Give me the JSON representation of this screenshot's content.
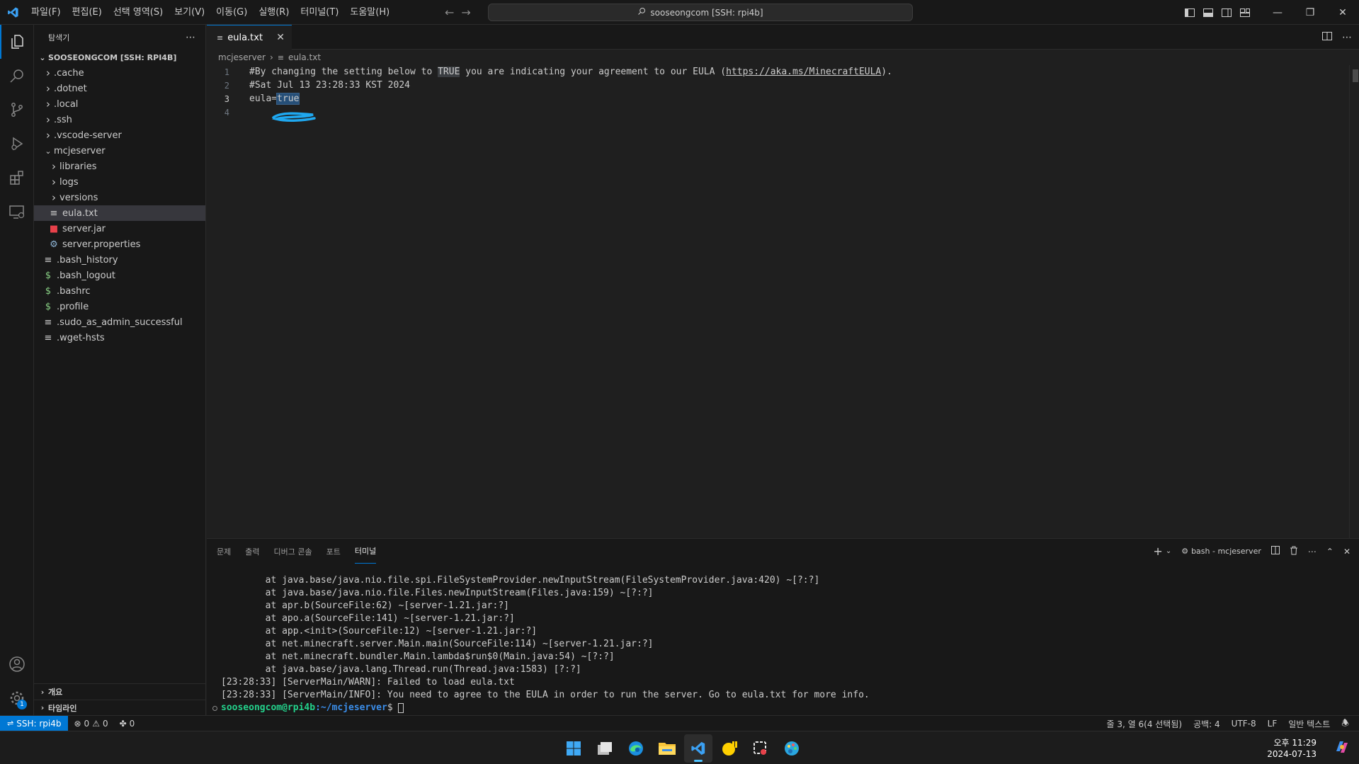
{
  "titlebar": {
    "menu": [
      "파일(F)",
      "편집(E)",
      "선택 영역(S)",
      "보기(V)",
      "이동(G)",
      "실행(R)",
      "터미널(T)",
      "도움말(H)"
    ],
    "search_text": "sooseongcom [SSH: rpi4b]"
  },
  "sidebar": {
    "title": "탐색기",
    "root": "SOOSEONGCOM [SSH: RPI4B]",
    "items": [
      {
        "label": ".cache",
        "type": "folder",
        "depth": 0,
        "expanded": false
      },
      {
        "label": ".dotnet",
        "type": "folder",
        "depth": 0,
        "expanded": false
      },
      {
        "label": ".local",
        "type": "folder",
        "depth": 0,
        "expanded": false
      },
      {
        "label": ".ssh",
        "type": "folder",
        "depth": 0,
        "expanded": false
      },
      {
        "label": ".vscode-server",
        "type": "folder",
        "depth": 0,
        "expanded": false
      },
      {
        "label": "mcjeserver",
        "type": "folder",
        "depth": 0,
        "expanded": true
      },
      {
        "label": "libraries",
        "type": "folder",
        "depth": 1,
        "expanded": false
      },
      {
        "label": "logs",
        "type": "folder",
        "depth": 1,
        "expanded": false
      },
      {
        "label": "versions",
        "type": "folder",
        "depth": 1,
        "expanded": false
      },
      {
        "label": "eula.txt",
        "type": "text",
        "depth": 1,
        "selected": true
      },
      {
        "label": "server.jar",
        "type": "jar",
        "depth": 1
      },
      {
        "label": "server.properties",
        "type": "gear",
        "depth": 1
      },
      {
        "label": ".bash_history",
        "type": "text",
        "depth": 0
      },
      {
        "label": ".bash_logout",
        "type": "shell",
        "depth": 0
      },
      {
        "label": ".bashrc",
        "type": "shell",
        "depth": 0
      },
      {
        "label": ".profile",
        "type": "shell",
        "depth": 0
      },
      {
        "label": ".sudo_as_admin_successful",
        "type": "text",
        "depth": 0
      },
      {
        "label": ".wget-hsts",
        "type": "text",
        "depth": 0
      }
    ],
    "outline": "개요",
    "timeline": "타임라인"
  },
  "editor": {
    "tab_label": "eula.txt",
    "breadcrumb": [
      "mcjeserver",
      "eula.txt"
    ],
    "lines": [
      {
        "num": "1",
        "before": "#By changing the setting below to ",
        "highlight": "TRUE",
        "middle": " you are indicating your agreement to our EULA (",
        "link": "https://aka.ms/MinecraftEULA",
        "after": ")."
      },
      {
        "num": "2",
        "text": "#Sat Jul 13 23:28:33 KST 2024"
      },
      {
        "num": "3",
        "before": "eula=",
        "selected": "true"
      },
      {
        "num": "4",
        "text": ""
      }
    ]
  },
  "panel": {
    "tabs": [
      "문제",
      "출력",
      "디버그 콘솔",
      "포트",
      "터미널"
    ],
    "active_tab": "터미널",
    "terminal_name": "bash - mcjeserver",
    "terminal_lines": [
      "        at java.base/java.nio.file.spi.FileSystemProvider.newInputStream(FileSystemProvider.java:420) ~[?:?]",
      "        at java.base/java.nio.file.Files.newInputStream(Files.java:159) ~[?:?]",
      "        at apr.b(SourceFile:62) ~[server-1.21.jar:?]",
      "        at apo.a(SourceFile:141) ~[server-1.21.jar:?]",
      "        at app.<init>(SourceFile:12) ~[server-1.21.jar:?]",
      "        at net.minecraft.server.Main.main(SourceFile:114) ~[server-1.21.jar:?]",
      "        at net.minecraft.bundler.Main.lambda$run$0(Main.java:54) ~[?:?]",
      "        at java.base/java.lang.Thread.run(Thread.java:1583) [?:?]",
      "[23:28:33] [ServerMain/WARN]: Failed to load eula.txt",
      "[23:28:33] [ServerMain/INFO]: You need to agree to the EULA in order to run the server. Go to eula.txt for more info."
    ],
    "prompt_user": "sooseongcom@rpi4b",
    "prompt_path": ":~/mcjeserver",
    "prompt_symbol": "$ "
  },
  "statusbar": {
    "remote": "SSH: rpi4b",
    "errors": "0",
    "warnings": "0",
    "ports": "0",
    "position": "줄 3, 열 6(4 선택됨)",
    "spaces": "공백: 4",
    "encoding": "UTF-8",
    "eol": "LF",
    "language": "일반 텍스트"
  },
  "taskbar": {
    "time": "오후 11:29",
    "date": "2024-07-13"
  },
  "colors": {
    "accent": "#0078d4",
    "terminal_user": "#23d18b",
    "terminal_path": "#3b8eea",
    "scribble": "#1fa8f0"
  },
  "activitybar": {
    "settings_badge": "1"
  }
}
